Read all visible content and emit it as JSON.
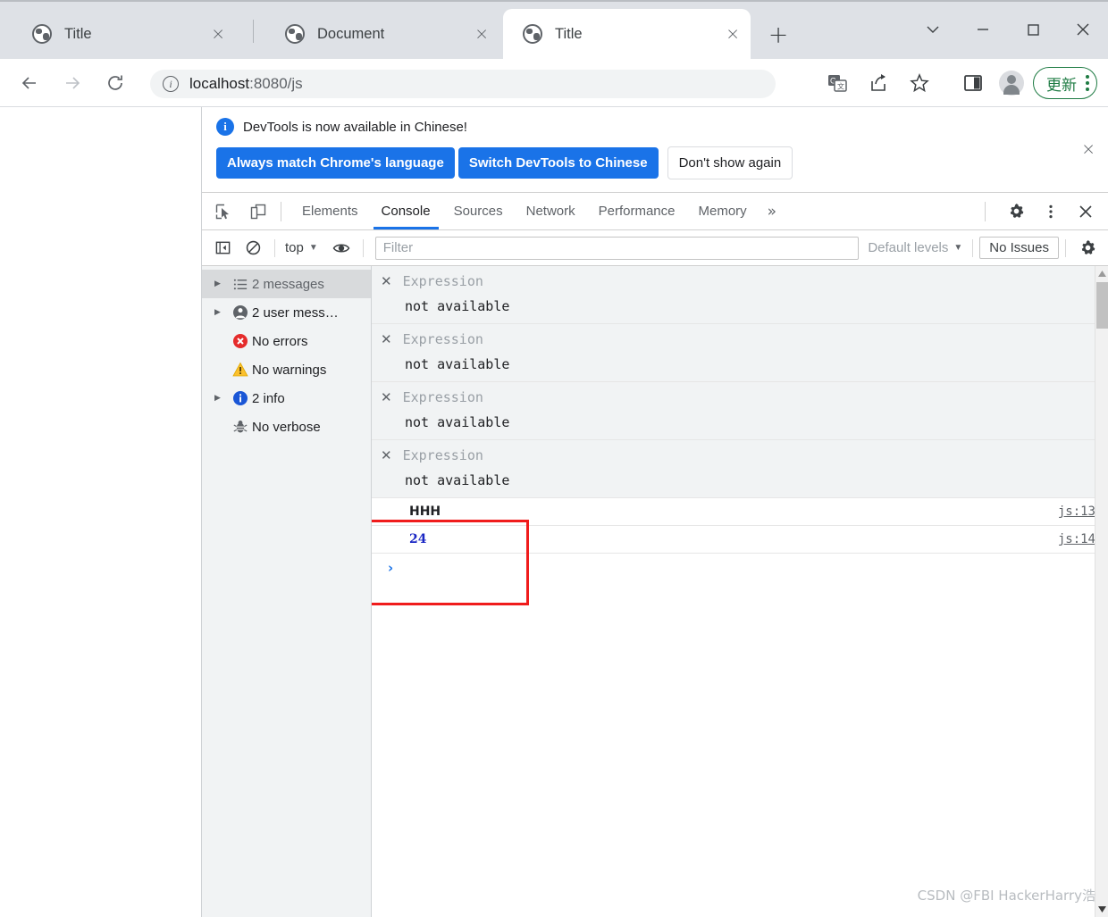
{
  "browser": {
    "tabs": [
      {
        "title": "Title",
        "active": false,
        "favicon": "globe-icon",
        "close": "×"
      },
      {
        "title": "Document",
        "active": false,
        "favicon": "globe-icon",
        "close": "×"
      },
      {
        "title": "Title",
        "active": true,
        "favicon": "globe-icon",
        "close": "×"
      }
    ],
    "new_tab_label": "+",
    "window_controls": [
      "tab-search-chevron",
      "minimize",
      "maximize",
      "close"
    ],
    "nav": {
      "back": "back-arrow",
      "forward": "forward-arrow",
      "reload": "reload-arrow"
    },
    "omnibox": {
      "info_icon": "i",
      "url_host": "localhost",
      "url_rest": ":8080/js"
    },
    "toolbar_icons": [
      "translate-icon",
      "share-icon",
      "bookmark-star-icon",
      "side-panel-icon"
    ],
    "profile": "avatar",
    "update_button": {
      "label": "更新",
      "color": "#1e7b43"
    }
  },
  "devtools": {
    "banner": {
      "icon": "i",
      "message": "DevTools is now available in Chinese!",
      "primary_1": "Always match Chrome's language",
      "primary_2": "Switch DevTools to Chinese",
      "secondary": "Don't show again",
      "close": "×"
    },
    "panel_tabs": [
      {
        "label": "Elements",
        "active": false
      },
      {
        "label": "Console",
        "active": true
      },
      {
        "label": "Sources",
        "active": false
      },
      {
        "label": "Network",
        "active": false
      },
      {
        "label": "Performance",
        "active": false
      },
      {
        "label": "Memory",
        "active": false
      }
    ],
    "more_tabs": "»",
    "console_toolbar": {
      "context": "top",
      "filter_placeholder": "Filter",
      "filter_value": "",
      "levels": "Default levels",
      "issues": "No Issues"
    },
    "sidebar": [
      {
        "label": "2 messages",
        "icon": "list-icon",
        "expandable": true,
        "selected": true
      },
      {
        "label": "2 user mess…",
        "icon": "user-icon",
        "expandable": true,
        "selected": false
      },
      {
        "label": "No errors",
        "icon": "error-icon",
        "expandable": false,
        "selected": false
      },
      {
        "label": "No warnings",
        "icon": "warning-icon",
        "expandable": false,
        "selected": false
      },
      {
        "label": "2 info",
        "icon": "info-icon",
        "expandable": true,
        "selected": false
      },
      {
        "label": "No verbose",
        "icon": "verbose-bug-icon",
        "expandable": false,
        "selected": false
      }
    ],
    "messages": [
      {
        "title": "Expression",
        "detail": "not available"
      },
      {
        "title": "Expression",
        "detail": "not available"
      },
      {
        "title": "Expression",
        "detail": "not available"
      },
      {
        "title": "Expression",
        "detail": "not available"
      }
    ],
    "logs": [
      {
        "text": "HHH",
        "kind": "string",
        "source": "js:13"
      },
      {
        "text": "24",
        "kind": "number",
        "source": "js:14"
      }
    ],
    "prompt": "›",
    "highlight_color": "#f01c1c"
  },
  "watermark": "CSDN @FBI HackerHarry浩"
}
